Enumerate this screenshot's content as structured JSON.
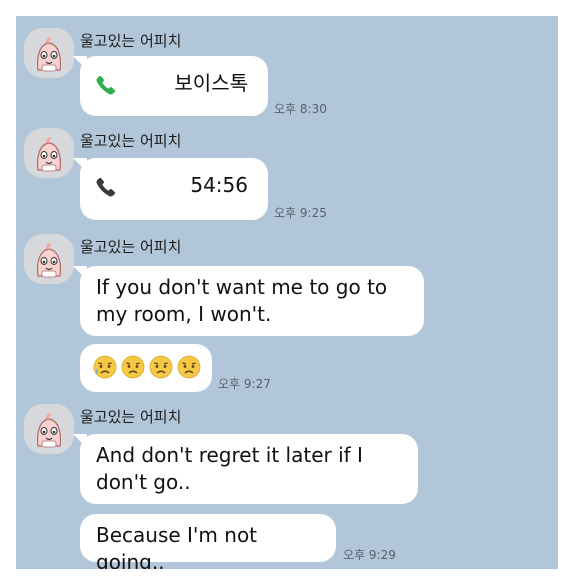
{
  "chat": {
    "background_color": "#b2c6d9",
    "sender_name": "울고있는 어피치",
    "groups": [
      {
        "sender": "울고있는 어피치",
        "call": {
          "icon": "phone-icon",
          "icon_color": "#2fb14f",
          "label": "보이스톡"
        },
        "time": "오후 8:30"
      },
      {
        "sender": "울고있는 어피치",
        "call": {
          "icon": "phone-icon",
          "icon_color": "#3b3b3b",
          "label": "54:56"
        },
        "time": "오후 9:25"
      },
      {
        "sender": "울고있는 어피치",
        "messages": [
          "If you don't want me to go to my room, I won't.",
          "😥😟😟😟"
        ],
        "time": "오후 9:27"
      },
      {
        "sender": "울고있는 어피치",
        "messages": [
          "And don't regret it later if I don't go..",
          "Because I'm not going.."
        ],
        "time": "오후 9:29"
      }
    ]
  }
}
